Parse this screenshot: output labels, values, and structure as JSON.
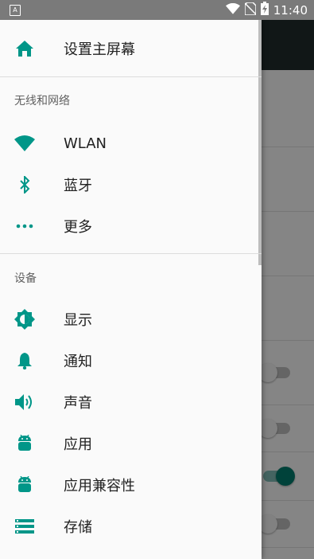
{
  "status_bar": {
    "notification_icon": "A",
    "time": "11:40",
    "icons": [
      "wifi-icon",
      "no-sim-icon",
      "battery-charging-icon"
    ]
  },
  "colors": {
    "accent": "#009688",
    "drawer_bg": "#fafafa",
    "status_bar": "#7a7a7a"
  },
  "drawer": {
    "home": {
      "label": "设置主屏幕",
      "icon": "home-icon"
    },
    "sections": [
      {
        "header": "无线和网络",
        "items": [
          {
            "label": "WLAN",
            "icon": "wifi-icon"
          },
          {
            "label": "蓝牙",
            "icon": "bluetooth-icon"
          },
          {
            "label": "更多",
            "icon": "more-horiz-icon"
          }
        ]
      },
      {
        "header": "设备",
        "items": [
          {
            "label": "显示",
            "icon": "brightness-icon"
          },
          {
            "label": "通知",
            "icon": "bell-icon"
          },
          {
            "label": "声音",
            "icon": "volume-icon"
          },
          {
            "label": "应用",
            "icon": "android-icon"
          },
          {
            "label": "应用兼容性",
            "icon": "android-icon"
          },
          {
            "label": "存储",
            "icon": "storage-icon"
          }
        ]
      }
    ]
  },
  "background_app": {
    "switches": [
      {
        "state": "off"
      },
      {
        "state": "off"
      },
      {
        "state": "on"
      },
      {
        "state": "off"
      }
    ]
  }
}
